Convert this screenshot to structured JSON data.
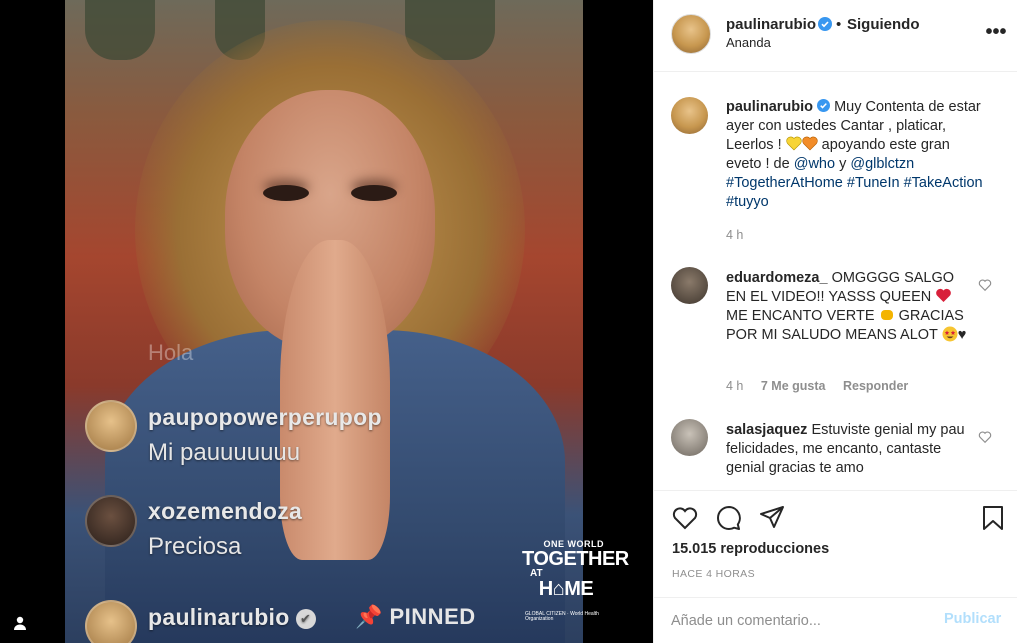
{
  "video": {
    "live_comments": [
      {
        "username": "Hola",
        "text": ""
      },
      {
        "username": "paupopowerperupop",
        "text": "Mi pauuuuuuu"
      },
      {
        "username": "xozemendoza",
        "text": "Preciosa"
      }
    ],
    "pinned": {
      "username": "paulinarubio",
      "pin_label": "📌 PINNED"
    },
    "logo": {
      "line1": "ONE WORLD",
      "line2": "TOGETHER",
      "line3": "AT",
      "line4": "H⌂ME",
      "orgs": "GLOBAL CITIZEN · World Health Organization"
    }
  },
  "header": {
    "username": "paulinarubio",
    "separator": "•",
    "follow_status": "Siguiendo",
    "location": "Ananda",
    "more": "•••"
  },
  "caption": {
    "username": "paulinarubio",
    "text_before": "Muy Contenta de estar ayer con ustedes Cantar , platicar, Leerlos ! ",
    "text_after": " apoyando este gran eveto ! de ",
    "mention1": "@who",
    "and": " y ",
    "mention2": "@glblctzn",
    "hashtags": "#TogetherAtHome #TuneIn #TakeAction #tuyyo",
    "time": "4 h"
  },
  "comments": [
    {
      "username": "eduardomeza_",
      "text_a": "OMGGGG SALGO EN EL VIDEO!! YASSS QUEEN ",
      "text_b": " ME ENCANTO VERTE ",
      "text_c": " GRACIAS POR MI SALUDO MEANS ALOT ",
      "text_d": "♥",
      "time": "4 h",
      "likes": "7 Me gusta",
      "reply": "Responder"
    },
    {
      "username": "salasjaquez",
      "text": "Estuviste genial my pau felicidades, me encanto, cantaste genial gracias te amo"
    }
  ],
  "stats": {
    "views": "15.015 reproducciones",
    "time_ago": "HACE 4 HORAS"
  },
  "composer": {
    "placeholder": "Añade un comentario...",
    "post_label": "Publicar"
  },
  "colors": {
    "link": "#00376b",
    "verified": "#3897f0",
    "muted": "#8e8e8e",
    "post_disabled": "#b2dffc"
  }
}
